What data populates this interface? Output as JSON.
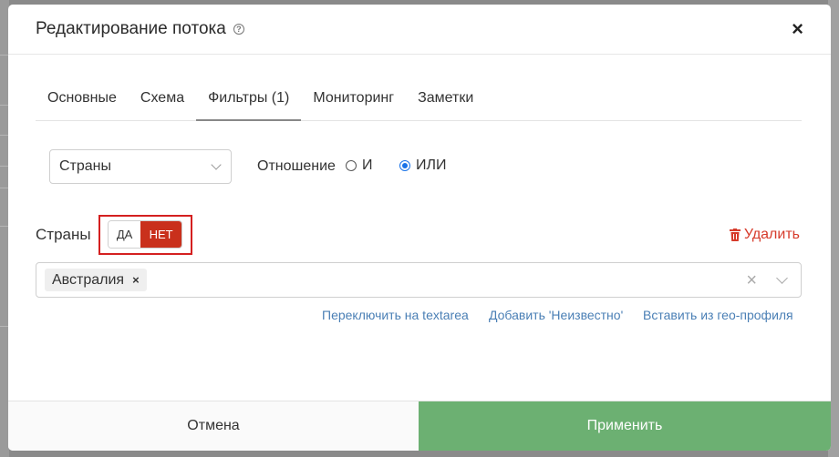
{
  "modal": {
    "title": "Редактирование потока",
    "close_label": "×"
  },
  "tabs": [
    {
      "label": "Основные"
    },
    {
      "label": "Схема"
    },
    {
      "label": "Фильтры (1)"
    },
    {
      "label": "Мониторинг"
    },
    {
      "label": "Заметки"
    }
  ],
  "active_tab": "Фильтры (1)",
  "filter": {
    "select_value": "Страны",
    "relation_label": "Отношение",
    "radio_and": "И",
    "radio_or": "ИЛИ",
    "selected_relation": "ИЛИ"
  },
  "countries": {
    "label": "Страны",
    "toggle_yes": "ДА",
    "toggle_no": "НЕТ",
    "toggle_selected": "НЕТ",
    "delete_label": "Удалить",
    "tags": [
      {
        "label": "Австралия",
        "remove": "×"
      }
    ],
    "clear_label": "×"
  },
  "links": {
    "switch_textarea": "Переключить на textarea",
    "add_unknown": "Добавить 'Неизвестно'",
    "insert_geo": "Вставить из гео-профиля"
  },
  "footer": {
    "cancel": "Отмена",
    "apply": "Применить"
  },
  "colors": {
    "apply_bg": "#6cb072",
    "toggle_active": "#c9301c",
    "delete_red": "#d63a2a",
    "highlight": "#d42020",
    "link_blue": "#4a7fb5"
  }
}
